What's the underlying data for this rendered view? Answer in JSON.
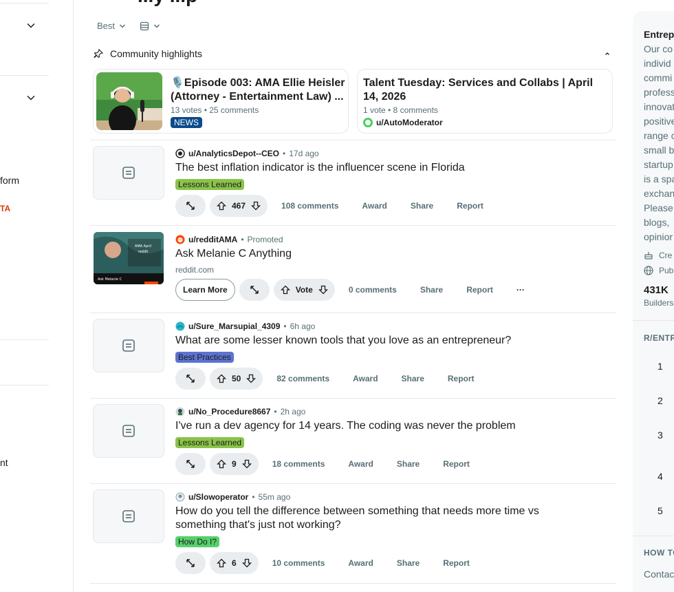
{
  "header": {
    "title_partial": "...y ...p"
  },
  "sort": {
    "label": "Best"
  },
  "leftnav": {
    "items": [
      "form",
      "TA",
      "nt"
    ]
  },
  "highlights": {
    "heading": "Community highlights",
    "cards": [
      {
        "title": "🎙️Episode 003: AMA Ellie Heisler (Attorney - Entertainment Law) ...",
        "meta": "13 votes • 25 comments",
        "badge": "NEWS"
      },
      {
        "title": "Talent Tuesday: Services and Collabs | April 14, 2026",
        "meta": "1 vote • 8 comments",
        "author": "u/AutoModerator"
      }
    ]
  },
  "posts": [
    {
      "author": "u/AnalyticsDepot--CEO",
      "age": "17d ago",
      "title": "The best inflation indicator is the influencer scene in Florida",
      "flair": "Lessons Learned",
      "flair_color": "#8bc34a",
      "votes": "467",
      "comments": "108 comments"
    },
    {
      "author": "u/redditAMA",
      "age": "Promoted",
      "title": "Ask Melanie C Anything",
      "domain": "reddit.com",
      "cta": "Learn More",
      "votes": "Vote",
      "comments": "0 comments"
    },
    {
      "author": "u/Sure_Marsupial_4309",
      "age": "6h ago",
      "title": "What are some lesser known tools that you love as an entrepreneur?",
      "flair": "Best Practices",
      "flair_color": "#5d73d1",
      "votes": "50",
      "comments": "82 comments"
    },
    {
      "author": "u/No_Procedure8667",
      "age": "2h ago",
      "title": "I've run a dev agency for 14 years. The coding was never the problem",
      "flair": "Lessons Learned",
      "flair_color": "#8bc34a",
      "votes": "9",
      "comments": "18 comments"
    },
    {
      "author": "u/Slowoperator",
      "age": "55m ago",
      "title": "How do you tell the difference between something that needs more time vs something that's just not working?",
      "flair": "How Do I?",
      "flair_color": "#56d16b",
      "votes": "6",
      "comments": "10 comments"
    }
  ],
  "actions": {
    "award": "Award",
    "share": "Share",
    "report": "Report",
    "more": "···"
  },
  "sidebar": {
    "title": "Entrep",
    "desc": [
      "Our co",
      "individ",
      "commi",
      "profess",
      "innovat",
      "positive",
      "range c",
      "small b",
      "startup",
      "is a spa",
      "exchan",
      "Please",
      "blogs,",
      "opinior"
    ],
    "created": "Cre",
    "public": "Pub",
    "members": "431K",
    "members_label": "Builders",
    "rank_heading": "R/ENTR",
    "ranks": [
      "1",
      "2",
      "3",
      "4",
      "5"
    ],
    "howto": "HOW TO",
    "contact": "Contac"
  }
}
